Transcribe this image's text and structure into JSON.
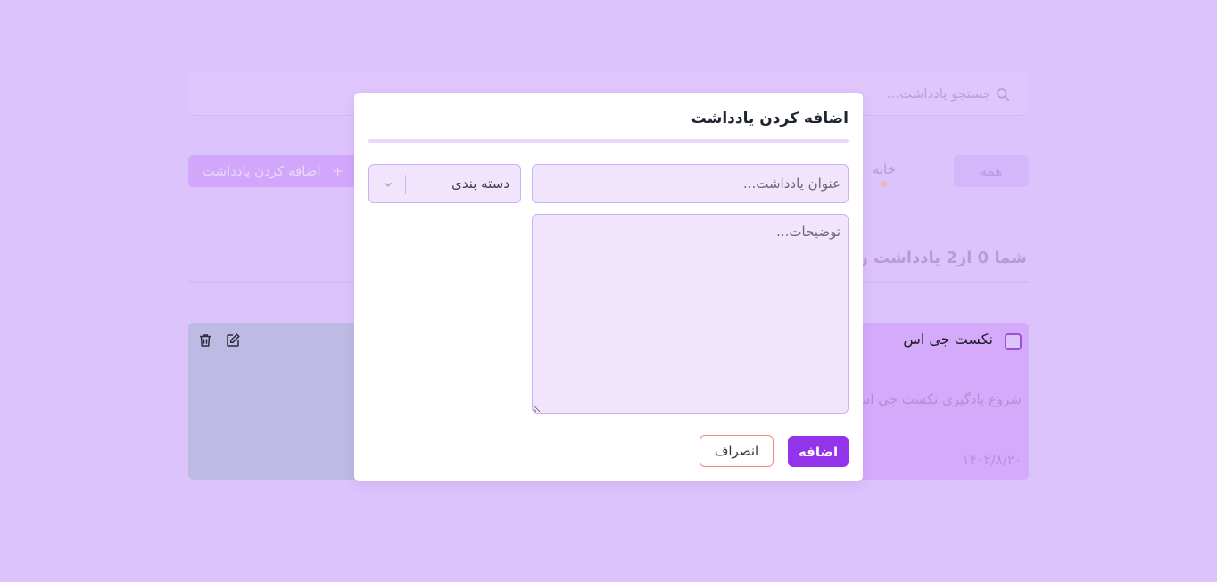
{
  "search": {
    "placeholder": "جستجو یادداشت..."
  },
  "filters": {
    "all_label": "همه",
    "home_label": "خانه"
  },
  "toolbar": {
    "add_note_label": "اضافه کردن یادداشت",
    "add_icon": "+"
  },
  "summary": {
    "text": "شما 0 از2 یادداشت را ان"
  },
  "note": {
    "title": "نکست جی اس",
    "description": "شروع یادگیری نکست جی اس",
    "date": "۱۴۰۲/۸/۲۰"
  },
  "modal": {
    "title": "اضافه کردن یادداشت",
    "title_placeholder": "عنوان یادداشت...",
    "category_label": "دسته بندی",
    "description_placeholder": "توضیحات...",
    "add_button": "اضافه",
    "cancel_button": "انصراف"
  },
  "colors": {
    "accent": "#9333ea",
    "overlay": "#ddc3fc",
    "input_bg": "#f1e4fd",
    "cancel_border": "#f08a8a"
  }
}
